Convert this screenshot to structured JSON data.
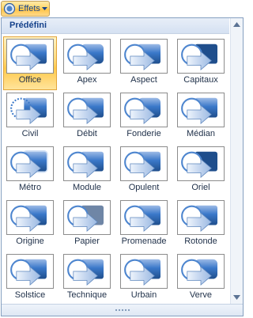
{
  "toolbar": {
    "effects_button_label": "Effets",
    "effects_icon": "theme-effects-icon",
    "dropdown_icon": "chevron-down-icon"
  },
  "gallery": {
    "section_title": "Prédéfini",
    "selected": "Office",
    "items": [
      {
        "label": "Office",
        "preview": "office"
      },
      {
        "label": "Apex",
        "preview": "apex"
      },
      {
        "label": "Aspect",
        "preview": "aspect"
      },
      {
        "label": "Capitaux",
        "preview": "capitaux"
      },
      {
        "label": "Civil",
        "preview": "civil"
      },
      {
        "label": "Débit",
        "preview": "debit"
      },
      {
        "label": "Fonderie",
        "preview": "fonderie"
      },
      {
        "label": "Médian",
        "preview": "median"
      },
      {
        "label": "Métro",
        "preview": "metro"
      },
      {
        "label": "Module",
        "preview": "module"
      },
      {
        "label": "Opulent",
        "preview": "opulent"
      },
      {
        "label": "Oriel",
        "preview": "oriel"
      },
      {
        "label": "Origine",
        "preview": "origine"
      },
      {
        "label": "Papier",
        "preview": "papier"
      },
      {
        "label": "Promenade",
        "preview": "promenade"
      },
      {
        "label": "Rotonde",
        "preview": "rotonde"
      },
      {
        "label": "Solstice",
        "preview": "solstice"
      },
      {
        "label": "Technique",
        "preview": "technique"
      },
      {
        "label": "Urbain",
        "preview": "urbain"
      },
      {
        "label": "Verve",
        "preview": "verve"
      }
    ]
  },
  "scrollbar": {
    "up_icon": "scroll-up-arrow-icon",
    "down_icon": "scroll-down-arrow-icon"
  },
  "resize_grip_icon": "resize-grip-icon",
  "colors": {
    "selected_fill": "#ffd86b",
    "selected_border": "#e2a53a",
    "header_text": "#15428b",
    "shape_blue": "#3a78c9",
    "shape_dark": "#1f4e8c",
    "shape_light": "#9dbbe6"
  }
}
